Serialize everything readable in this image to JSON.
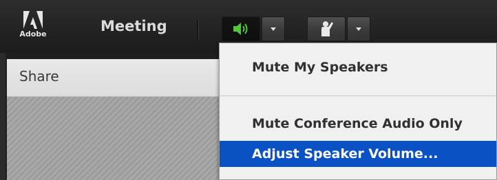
{
  "app": {
    "logo_text": "Adobe"
  },
  "toolbar": {
    "meeting_label": "Meeting",
    "speaker_icon": "speaker-icon",
    "mic_icon": "presenter-icon",
    "accent_speaker": "#4fc93a"
  },
  "pod": {
    "title": "Share"
  },
  "speaker_menu": {
    "items": [
      {
        "label": "Mute My Speakers"
      },
      {
        "label": "Mute Conference Audio Only"
      },
      {
        "label": "Adjust Speaker Volume..."
      }
    ],
    "highlight_color": "#0a52c4"
  }
}
